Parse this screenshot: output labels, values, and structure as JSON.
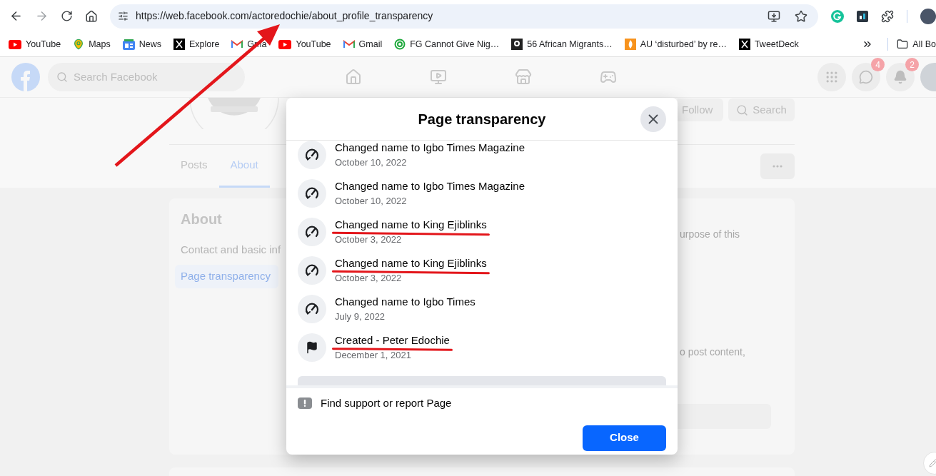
{
  "browser": {
    "url": "https://web.facebook.com/actoredochie/about_profile_transparency",
    "bookmarks": [
      {
        "label": "YouTube",
        "kind": "youtube"
      },
      {
        "label": "Maps",
        "kind": "maps"
      },
      {
        "label": "News",
        "kind": "news"
      },
      {
        "label": "Explore",
        "kind": "x"
      },
      {
        "label": "Gma",
        "kind": "gmail"
      },
      {
        "label": "YouTube",
        "kind": "youtube"
      },
      {
        "label": "Gmail",
        "kind": "gmail"
      },
      {
        "label": "FG Cannot Give Nig…",
        "kind": "ring"
      },
      {
        "label": "56 African Migrants…",
        "kind": "g"
      },
      {
        "label": "AU ‘disturbed’ by re…",
        "kind": "flame"
      },
      {
        "label": "TweetDeck",
        "kind": "x"
      }
    ],
    "all_bookmarks": "All Bo"
  },
  "facebook": {
    "search_placeholder": "Search Facebook",
    "messenger_badge": "4",
    "notifications_badge": "2",
    "follow": "Follow",
    "search_button": "Search",
    "tabs": [
      {
        "label": "Posts",
        "selected": false
      },
      {
        "label": "About",
        "selected": true
      }
    ],
    "about": {
      "title": "About",
      "items": [
        {
          "label": "Contact and basic inf",
          "selected": false
        },
        {
          "label": "Page transparency",
          "selected": true
        }
      ],
      "fragments": [
        "urpose of this",
        "o post content,"
      ]
    }
  },
  "modal": {
    "title": "Page transparency",
    "entries": [
      {
        "kind": "name_change",
        "title": "Changed name to Igbo Times Magazine",
        "date": "October 10, 2022",
        "underlined": false
      },
      {
        "kind": "name_change",
        "title": "Changed name to Igbo Times Magazine",
        "date": "October 10, 2022",
        "underlined": false
      },
      {
        "kind": "name_change",
        "title": "Changed name to King Ejiblinks",
        "date": "October 3, 2022",
        "underlined": true
      },
      {
        "kind": "name_change",
        "title": "Changed name to King Ejiblinks",
        "date": "October 3, 2022",
        "underlined": true
      },
      {
        "kind": "name_change",
        "title": "Changed name to Igbo Times",
        "date": "July 9, 2022",
        "underlined": false
      },
      {
        "kind": "created",
        "title": "Created - Peter Edochie",
        "date": "December 1, 2021",
        "underlined": true
      }
    ],
    "footer_link": "Find support or report Page",
    "close_button": "Close"
  }
}
